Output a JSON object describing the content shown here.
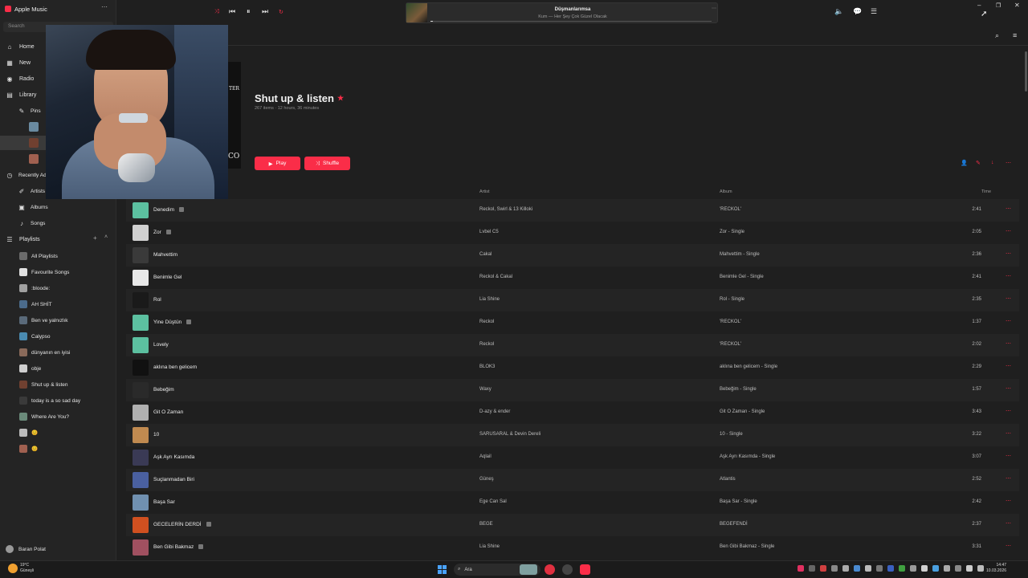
{
  "app": {
    "title": "Apple Music",
    "menu_icon": "ellipsis-icon"
  },
  "sidebar": {
    "search_placeholder": "Search",
    "nav": [
      {
        "label": "Home",
        "icon": "house-icon"
      },
      {
        "label": "New",
        "icon": "grid-icon"
      },
      {
        "label": "Radio",
        "icon": "radio-icon"
      }
    ],
    "library_label": "Library",
    "library": [
      {
        "label": "Pins",
        "icon": "pin-icon"
      },
      {
        "label": "Recently Added",
        "icon": "clock-icon"
      },
      {
        "label": "Artists",
        "icon": "mic-icon"
      },
      {
        "label": "Albums",
        "icon": "album-icon"
      },
      {
        "label": "Songs",
        "icon": "note-icon"
      }
    ],
    "playlists_label": "Playlists",
    "playlists": [
      {
        "label": "All Playlists",
        "color": "#6b6b6b"
      },
      {
        "label": "Favourite Songs",
        "color": "#e0e0e0"
      },
      {
        "label": ":bloode:",
        "color": "#a0a0a0"
      },
      {
        "label": "AH SHİT",
        "color": "#4b6b8b"
      },
      {
        "label": "Ben ve yalnızlık",
        "color": "#5a6a7a"
      },
      {
        "label": "Calypso",
        "color": "#4a8ab0"
      },
      {
        "label": "dünyanın en iyisi",
        "color": "#8a6a5a"
      },
      {
        "label": "obje",
        "color": "#cfcfcf"
      },
      {
        "label": "Shut up & listen",
        "color": "#704030"
      },
      {
        "label": "today is a so sad day",
        "color": "#3a3a3a"
      },
      {
        "label": "Where Are You?",
        "color": "#6a8a7a"
      },
      {
        "label": "😊",
        "color": "#bbbbbb"
      },
      {
        "label": "😊",
        "color": "#a06050"
      }
    ],
    "user": "Baran Polat"
  },
  "player": {
    "now_title": "Düşmanlarımsa",
    "now_subtitle": "Kum — Her Şey Çok Güzel Olacak"
  },
  "playlist": {
    "title": "Shut up & listen",
    "meta": "267 items · 12 hours, 36 minutes",
    "play_label": "Play",
    "shuffle_label": "Shuffle",
    "art_letters_top": "TER",
    "art_letters_bottom": "CO"
  },
  "table": {
    "headers": {
      "artist": "Artist",
      "album": "Album",
      "time": "Time"
    },
    "rows": [
      {
        "title": "Denedim",
        "explicit": true,
        "artist": "Reckol, Swirl & 13 Killoki",
        "album": "'RECKOL'",
        "time": "2:41",
        "color": "#5cc0a0"
      },
      {
        "title": "Zor",
        "explicit": true,
        "artist": "Lvbel C5",
        "album": "Zor - Single",
        "time": "2:05",
        "color": "#d0d0d0"
      },
      {
        "title": "Mahvettim",
        "explicit": false,
        "artist": "Cakal",
        "album": "Mahvettim - Single",
        "time": "2:36",
        "color": "#3a3a3a"
      },
      {
        "title": "Benimle Gel",
        "explicit": false,
        "artist": "Reckol & Cakal",
        "album": "Benimle Gel - Single",
        "time": "2:41",
        "color": "#e8e8e8"
      },
      {
        "title": "Rol",
        "explicit": false,
        "artist": "Lia Shine",
        "album": "Rol - Single",
        "time": "2:35",
        "color": "#1a1a1a"
      },
      {
        "title": "Yine Düştün",
        "explicit": true,
        "artist": "Reckol",
        "album": "'RECKOL'",
        "time": "1:37",
        "color": "#5cc0a0"
      },
      {
        "title": "Lovely",
        "explicit": false,
        "artist": "Reckol",
        "album": "'RECKOL'",
        "time": "2:02",
        "color": "#5cc0a0"
      },
      {
        "title": "aklına ben gelicem",
        "explicit": false,
        "artist": "BLOK3",
        "album": "aklına ben gelicem - Single",
        "time": "2:29",
        "color": "#111111"
      },
      {
        "title": "Bebeğim",
        "explicit": false,
        "artist": "Waxy",
        "album": "Bebeğim - Single",
        "time": "1:57",
        "color": "#2a2a2a"
      },
      {
        "title": "Git O Zaman",
        "explicit": false,
        "artist": "D-azy & ender",
        "album": "Git O Zaman - Single",
        "time": "3:43",
        "color": "#b0b0b0"
      },
      {
        "title": "10",
        "explicit": false,
        "artist": "SARUSARAL & Devin Dereli",
        "album": "10 - Single",
        "time": "3:22",
        "color": "#c08a50"
      },
      {
        "title": "Aşk Ayrı Kasımda",
        "explicit": false,
        "artist": "Aqlail",
        "album": "Aşk Ayrı Kasımda - Single",
        "time": "3:07",
        "color": "#3a3a55"
      },
      {
        "title": "Suçlanmadan Biri",
        "explicit": false,
        "artist": "Güneş",
        "album": "Atlantis",
        "time": "2:52",
        "color": "#4a60a0"
      },
      {
        "title": "Başa Sar",
        "explicit": false,
        "artist": "Ege Can Sal",
        "album": "Başa Sar - Single",
        "time": "2:42",
        "color": "#7090b0"
      },
      {
        "title": "GECELERİN DERDİ",
        "explicit": true,
        "artist": "BEGE",
        "album": "BEGEFENDİ",
        "time": "2:37",
        "color": "#d05020"
      },
      {
        "title": "Ben Gibi Bakmaz",
        "explicit": true,
        "artist": "Lia Shine",
        "album": "Ben Gibi Bakmaz - Single",
        "time": "3:31",
        "color": "#a05060"
      }
    ]
  },
  "taskbar": {
    "weather_temp": "19°C",
    "weather_desc": "Güneşli",
    "search_label": "Ara",
    "time": "14:47",
    "date": "10.03.2026"
  },
  "colors": {
    "accent": "#fa2d48",
    "background": "#1f1f1f",
    "sidebar": "#242424"
  }
}
